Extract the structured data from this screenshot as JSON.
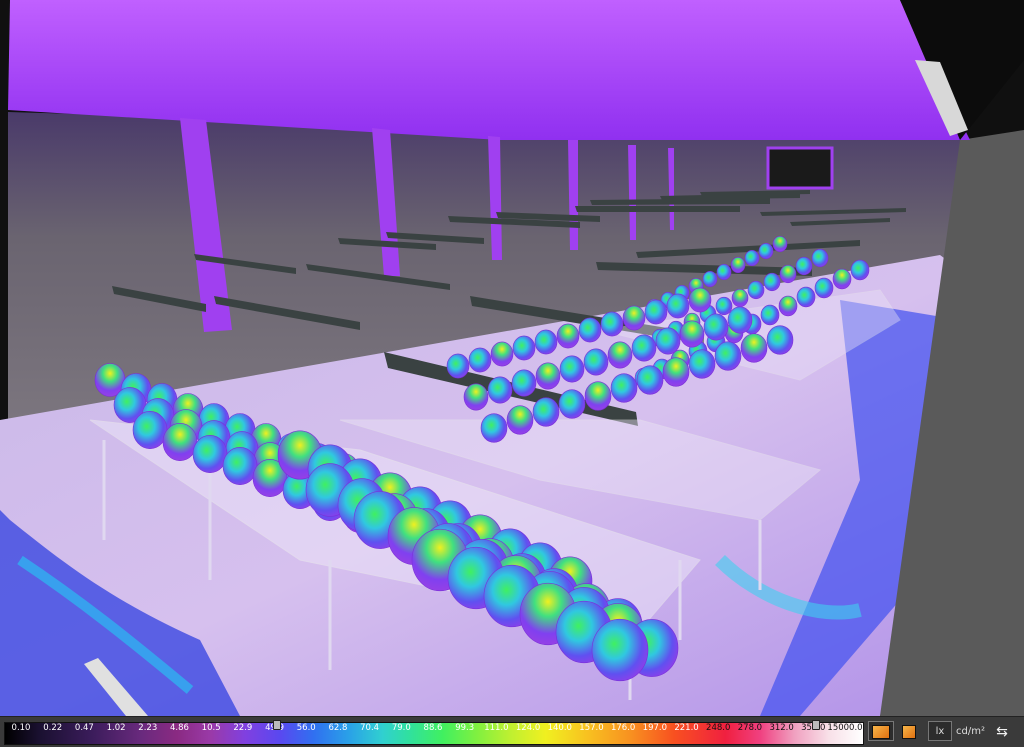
{
  "legend": {
    "ticks": [
      "0.10",
      "0.22",
      "0.47",
      "1.02",
      "2.23",
      "4.86",
      "10.5",
      "22.9",
      "49.9",
      "56.0",
      "62.8",
      "70.4",
      "79.0",
      "88.6",
      "99.3",
      "111.0",
      "124.0",
      "140.0",
      "157.0",
      "176.0",
      "197.0",
      "221.0",
      "248.0",
      "278.0",
      "312.0",
      "350.0",
      "15000.0"
    ],
    "slider_low": "49.9",
    "slider_high": "350.0"
  },
  "toolbar": {
    "lx_label": "lx",
    "cdm2_label": "cd/m²"
  },
  "colors": {
    "ceiling": "#a040f0",
    "floor": "#c070f8",
    "bench_glass": "#e8e0f8",
    "lamp_bar": "#3c4040"
  }
}
